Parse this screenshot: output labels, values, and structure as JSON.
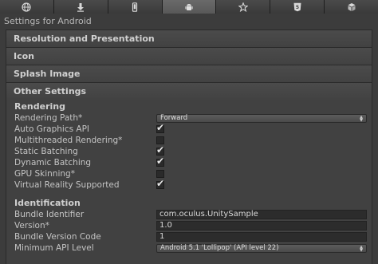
{
  "platform_tabs": [
    {
      "name": "web-globe-icon",
      "active": false
    },
    {
      "name": "download-icon",
      "active": false
    },
    {
      "name": "ios-device-icon",
      "active": false
    },
    {
      "name": "android-icon",
      "active": true
    },
    {
      "name": "samsung-tv-icon",
      "active": false
    },
    {
      "name": "html5-icon",
      "active": false
    },
    {
      "name": "blackberry-cube-icon",
      "active": false
    }
  ],
  "title": "Settings for Android",
  "sections": {
    "resolution": "Resolution and Presentation",
    "icon": "Icon",
    "splash": "Splash Image",
    "other": "Other Settings"
  },
  "rendering": {
    "title": "Rendering",
    "rendering_path": {
      "label": "Rendering Path*",
      "value": "Forward"
    },
    "auto_graphics_api": {
      "label": "Auto Graphics API",
      "checked": true
    },
    "multithreaded_rendering": {
      "label": "Multithreaded Rendering*",
      "checked": false
    },
    "static_batching": {
      "label": "Static Batching",
      "checked": true
    },
    "dynamic_batching": {
      "label": "Dynamic Batching",
      "checked": true
    },
    "gpu_skinning": {
      "label": "GPU Skinning*",
      "checked": false
    },
    "vr_supported": {
      "label": "Virtual Reality Supported",
      "checked": true
    }
  },
  "identification": {
    "title": "Identification",
    "bundle_identifier": {
      "label": "Bundle Identifier",
      "value": "com.oculus.UnitySample"
    },
    "version": {
      "label": "Version*",
      "value": "1.0"
    },
    "bundle_version_code": {
      "label": "Bundle Version Code",
      "value": "1"
    },
    "min_api_level": {
      "label": "Minimum API Level",
      "value": "Android 5.1 'Lollipop' (API level 22)"
    }
  },
  "check_glyph": "✔",
  "dropdown_arrow": "▲▼"
}
